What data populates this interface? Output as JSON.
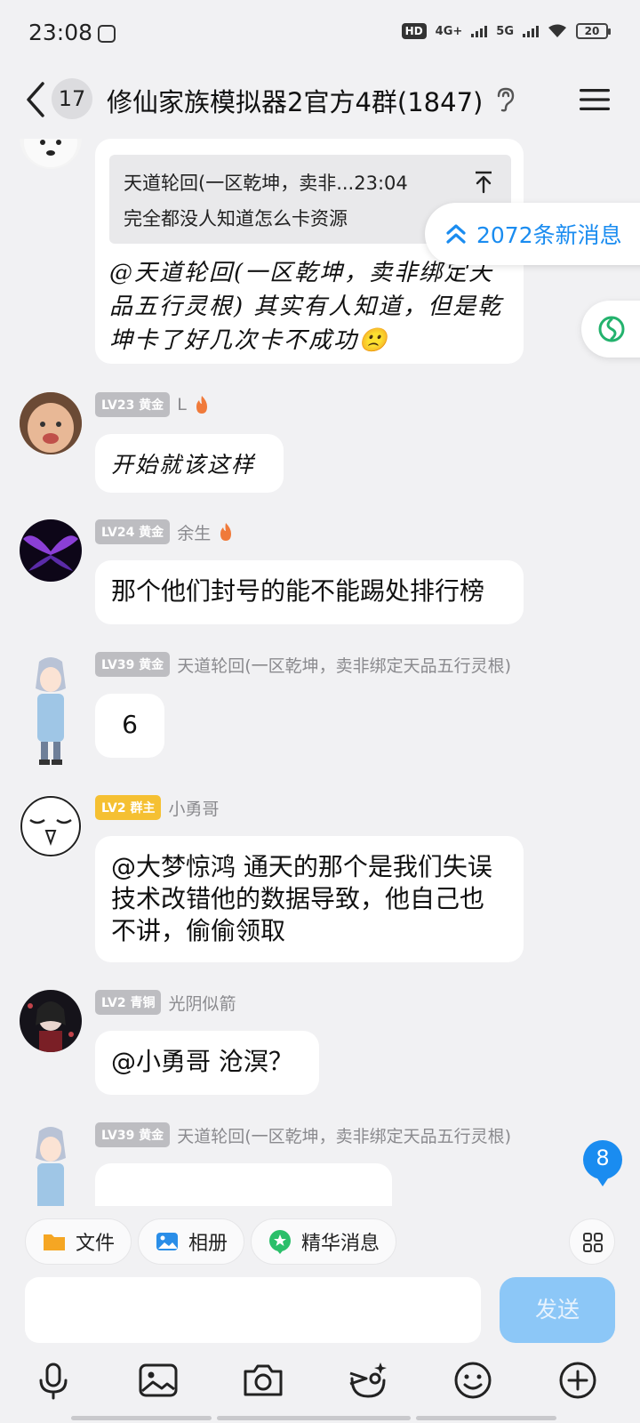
{
  "status_bar": {
    "time": "23:08",
    "network_hd": "HD",
    "network_4g": "4G+",
    "network_5g": "5G",
    "battery": "20"
  },
  "title_bar": {
    "unread_count": "17",
    "group_title": "修仙家族模拟器2官方4群(1847)"
  },
  "quote": {
    "header": "天道轮回(一区乾坤，卖非...23:04",
    "text": "完全都没人知道怎么卡资源"
  },
  "new_messages": "2072条新消息",
  "messages": [
    {
      "level": "",
      "title": "",
      "nick": "",
      "text": "@天道轮回(一区乾坤，卖非绑定天品五行灵根) 其实有人知道，但是乾坤卡了好几次卡不成功🙁"
    },
    {
      "level": "LV23",
      "title": "黄金",
      "nick": "L",
      "text": "开始就该这样"
    },
    {
      "level": "LV24",
      "title": "黄金",
      "nick": "余生",
      "text": "那个他们封号的能不能踢处排行榜"
    },
    {
      "level": "LV39",
      "title": "黄金",
      "nick": "天道轮回(一区乾坤，卖非绑定天品五行灵根)",
      "text": "6"
    },
    {
      "level": "LV2",
      "title": "群主",
      "nick": "小勇哥",
      "text": "@大梦惊鸿  通天的那个是我们失误  技术改错他的数据导致，他自己也不讲，偷偷领取"
    },
    {
      "level": "LV2",
      "title": "青铜",
      "nick": "光阴似箭",
      "text": "@小勇哥  沧溟？"
    },
    {
      "level": "LV39",
      "title": "黄金",
      "nick": "天道轮回(一区乾坤，卖非绑定天品五行灵根)",
      "text": ""
    }
  ],
  "mention_badge": "8",
  "toolbar": {
    "file": "文件",
    "album": "相册",
    "essence": "精华消息"
  },
  "input": {
    "placeholder": ""
  },
  "send_label": "发送",
  "colors": {
    "accent": "#1a8cf0",
    "send_disabled": "#8cc7f7",
    "owner_badge": "#f5c032",
    "level_badge": "#bdbdc1"
  }
}
